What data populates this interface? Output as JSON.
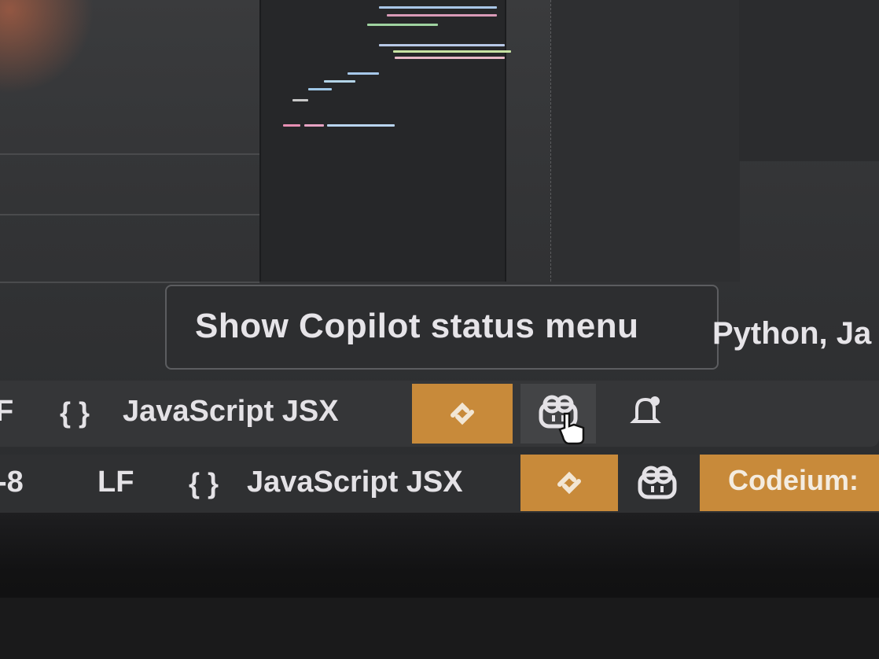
{
  "tooltip": {
    "text": "Show Copilot status menu"
  },
  "overlay_clipped": {
    "text": "Python, Ja"
  },
  "status_bar_top": {
    "partial_left": "F",
    "language_braces": "{ }",
    "language_label": "JavaScript JSX",
    "accent_color": "#c88a3a"
  },
  "status_bar_bottom": {
    "encoding_partial": "-8",
    "line_ending": "LF",
    "language_braces": "{ }",
    "language_label": "JavaScript JSX",
    "codeium_label": "Codeium: ",
    "accent_color": "#c88a3a"
  },
  "icons": {
    "sync": "sync-icon",
    "copilot": "copilot-icon",
    "bell": "bell-icon",
    "cursor": "hand-pointer-icon"
  }
}
